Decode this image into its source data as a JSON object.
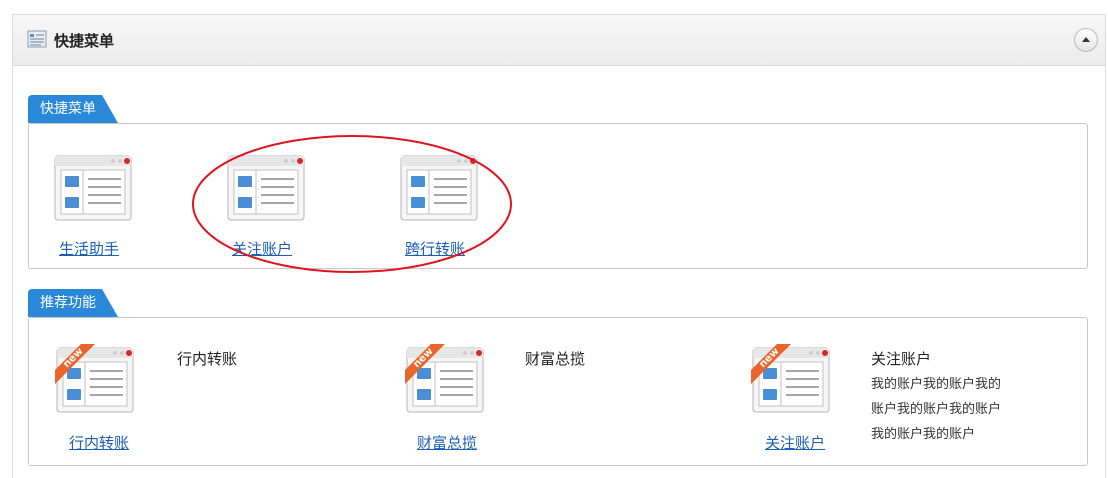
{
  "panel": {
    "title": "快捷菜单",
    "collapse_icon": "chevron-up-icon"
  },
  "quick_menu": {
    "tab": "快捷菜单",
    "items": [
      {
        "label": "生活助手"
      },
      {
        "label": "关注账户"
      },
      {
        "label": "跨行转账"
      }
    ]
  },
  "recommended": {
    "tab": "推荐功能",
    "items": [
      {
        "label": "行内转账",
        "title": "行内转账",
        "desc": [],
        "badge": "new"
      },
      {
        "label": "财富总揽",
        "title": "财富总揽",
        "desc": [],
        "badge": "new"
      },
      {
        "label": "关注账户",
        "title": "关注账户",
        "desc": [
          "我的账户我的账户我的",
          "账户我的账户我的账户",
          "我的账户我的账户"
        ],
        "badge": "new"
      }
    ]
  },
  "colors": {
    "tab_blue": "#2a88d9",
    "link_blue": "#1a5fb4",
    "annotation_red": "#e0141e",
    "badge_orange": "#e8662a"
  }
}
